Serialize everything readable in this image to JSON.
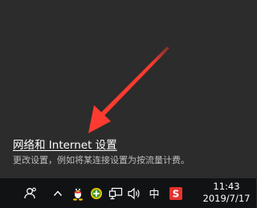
{
  "flyout": {
    "link_label": "网络和 Internet 设置",
    "description": "更改设置，例如将某连接设置为按流量计费。"
  },
  "annotation": {
    "arrow_color": "#ff3b30"
  },
  "taskbar": {
    "icons": [
      "people-icon",
      "show-hidden-icons-chevron-icon",
      "qq-penguin-icon",
      "green-plus-app-icon",
      "network-icon",
      "volume-icon",
      "ime-chinese-icon",
      "sogou-input-icon"
    ],
    "ime_label": "中",
    "sogou_label": "S",
    "clock": {
      "time": "11:43",
      "date": "2019/7/17"
    }
  },
  "colors": {
    "flyout_bg": "#2c2c2c",
    "taskbar_bg": "#111214",
    "sogou_red": "#e5322d",
    "qq_yellow": "#f5c400"
  }
}
